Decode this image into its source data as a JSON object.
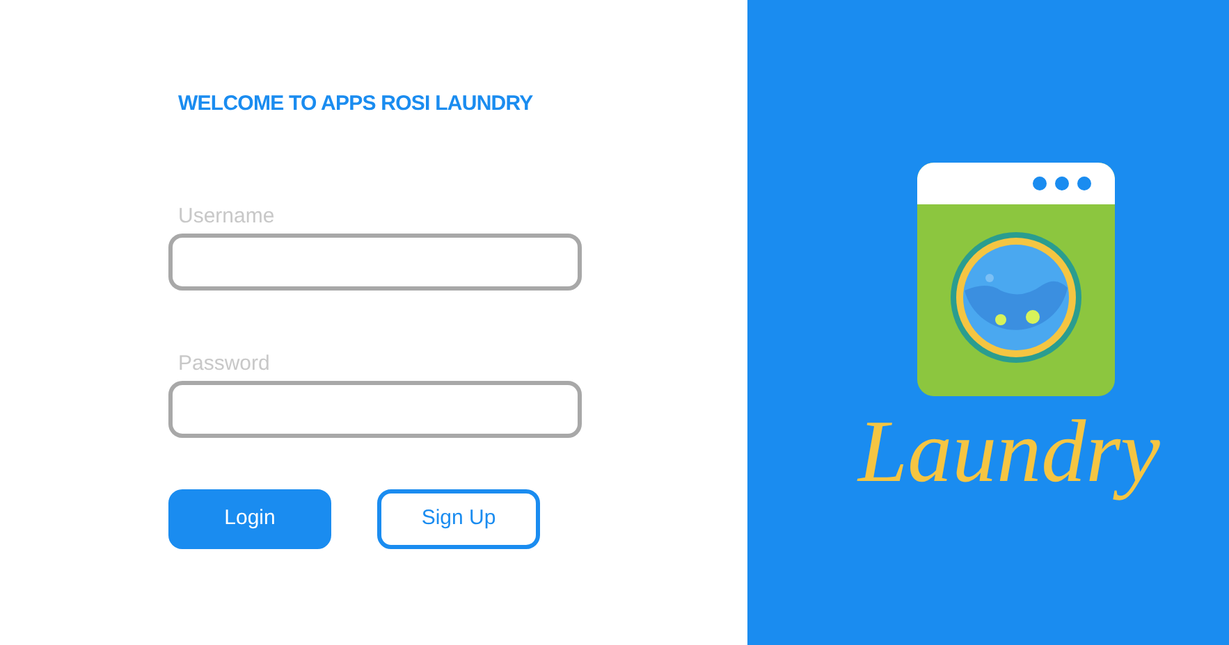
{
  "title": "WELCOME TO APPS ROSI LAUNDRY",
  "fields": [
    {
      "label": "Username"
    },
    {
      "label": "Password"
    }
  ],
  "buttons": [
    {
      "label": "Login",
      "kind": "primary"
    },
    {
      "label": "Sign Up",
      "kind": "outline"
    }
  ],
  "logo": {
    "text": "Laundry"
  }
}
